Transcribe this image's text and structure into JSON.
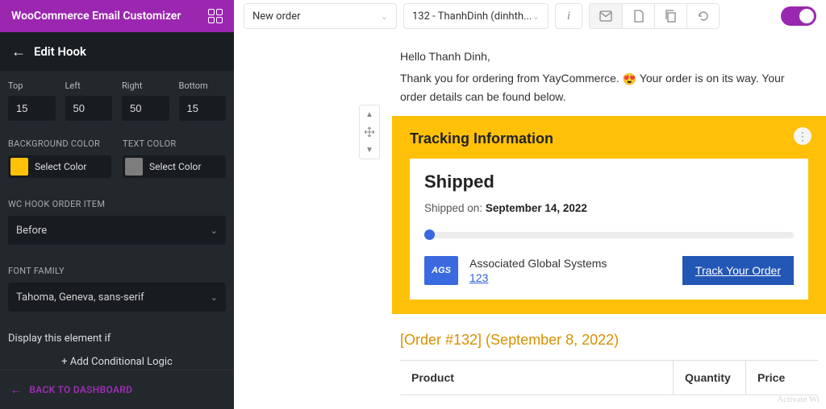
{
  "brand": {
    "title": "WooCommerce Email Customizer"
  },
  "top": {
    "email_type": "New order",
    "order_select": "132 - ThanhDinh (dinhth...",
    "info_btn": "i"
  },
  "sidebar": {
    "header_title": "Edit Hook",
    "padding": {
      "top_label": "Top",
      "top": "15",
      "left_label": "Left",
      "left": "50",
      "right_label": "Right",
      "right": "50",
      "bottom_label": "Bottom",
      "bottom": "15"
    },
    "bg_label": "BACKGROUND COLOR",
    "text_label": "TEXT COLOR",
    "color_select_txt": "Select Color",
    "bg_swatch": "#ffc107",
    "text_swatch": "#7d7d7d",
    "hook_label": "WC HOOK ORDER ITEM",
    "hook_value": "Before",
    "font_label": "FONT FAMILY",
    "font_value": "Tahoma, Geneva, sans-serif",
    "cond_label": "Display this element if",
    "add_cond": "+ Add Conditional Logic",
    "dashboard": "BACK TO DASHBOARD"
  },
  "email": {
    "greeting": "Hello Thanh Dinh,",
    "intro": "Thank you for ordering from YayCommerce. ",
    "intro2": " Your order is on its way. Your order details can be found below.",
    "emoji": "😍",
    "tracking_title": "Tracking Information",
    "status": "Shipped",
    "shipped_label": "Shipped on: ",
    "shipped_date": "September 14, 2022",
    "carrier": {
      "logo": "AGS",
      "name": "Associated Global Systems",
      "num": "123"
    },
    "track_btn": "Track Your Order",
    "order_heading": "[Order #132] (September 8, 2022)",
    "table": {
      "product": "Product",
      "qty": "Quantity",
      "price": "Price"
    }
  },
  "watermark": "Activate Wi"
}
